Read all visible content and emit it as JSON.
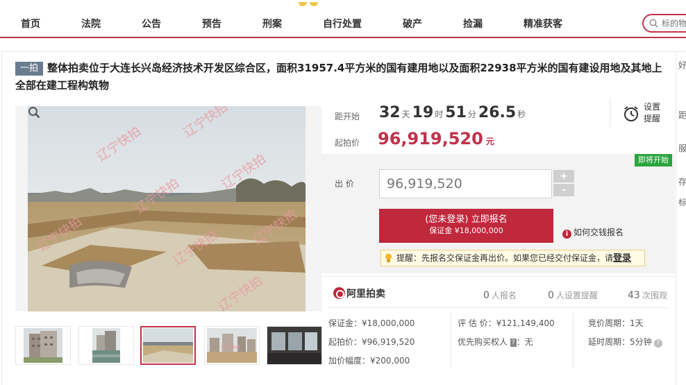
{
  "nav": {
    "items": [
      "首页",
      "法院",
      "公告",
      "预告",
      "刑案",
      "自行处置",
      "破产",
      "捡漏",
      "精准获客"
    ],
    "search_placeholder": "标的物"
  },
  "right_strip": {
    "chars": [
      "好",
      "距",
      "服",
      "存",
      "标"
    ]
  },
  "auction": {
    "tag": "一拍",
    "title": "整体拍卖位于大连长兴岛经济技术开发区综合区，面积31957.4平方米的国有建用地以及面积22938平方米的国有建设用地及其地上全部在建工程构筑物",
    "watermark": "辽宁快拍"
  },
  "countdown": {
    "label": "距开始",
    "days": "32",
    "days_unit": "天",
    "hours": "19",
    "hours_unit": "时",
    "minutes": "51",
    "minutes_unit": "分",
    "seconds": "26.5",
    "seconds_unit": "秒"
  },
  "reminder": {
    "label": "设置提醒"
  },
  "start_price": {
    "label": "起拍价",
    "value": "96,919,520",
    "unit": "元"
  },
  "bid": {
    "status_badge": "即将开始",
    "label": "出 价",
    "input_value": "96,919,520",
    "plus": "+",
    "minus": "-",
    "signup_line1": "(您未登录) 立即报名",
    "signup_line2": "保证金 ¥18,000,000",
    "how_to_pay": "如何交钱报名",
    "tip_text": "提醒：先报名交保证金再出价。如果您已经交付保证金，请",
    "tip_login": "登录"
  },
  "stats": {
    "platform": "阿里拍卖",
    "signup_count": "0",
    "signup_label": "人报名",
    "remind_count": "0",
    "remind_label": "人设置提醒",
    "views_count": "43",
    "views_label": "次围观"
  },
  "details": {
    "deposit": "保证金：¥18,000,000",
    "start_price": "起拍价：¥96,919,520",
    "increment": "加价幅度：¥200,000",
    "appraisal": "评 估 价：¥121,149,400",
    "priority_label": "优先购买权人",
    "priority_badge": "?",
    "priority_value": "：无",
    "bid_period": "竞价周期：1天",
    "delay_period": "延时周期：5分钟"
  },
  "colors": {
    "brand": "#c0324a",
    "badge_green": "#2aa43e"
  }
}
